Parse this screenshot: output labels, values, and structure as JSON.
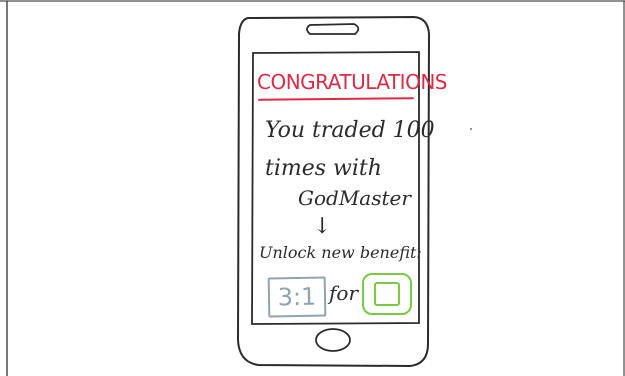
{
  "screen": {
    "title": "CONGRATULATIONS",
    "message_line1": "You traded 100",
    "message_line2": "times with",
    "partner_name": "GodMaster",
    "arrow": "↓",
    "benefit_label": "Unlock new benefit:",
    "ratio": "3:1",
    "for_label": "for"
  },
  "colors": {
    "title": "#e02a44",
    "ratio_box": "#8fa4ad",
    "reward_box": "#7ac943",
    "ink": "#2b2b2b"
  },
  "icons": {
    "reward": "square-in-rounded-square-icon",
    "home_button": "home-button-icon",
    "speaker": "speaker-slot-icon"
  }
}
